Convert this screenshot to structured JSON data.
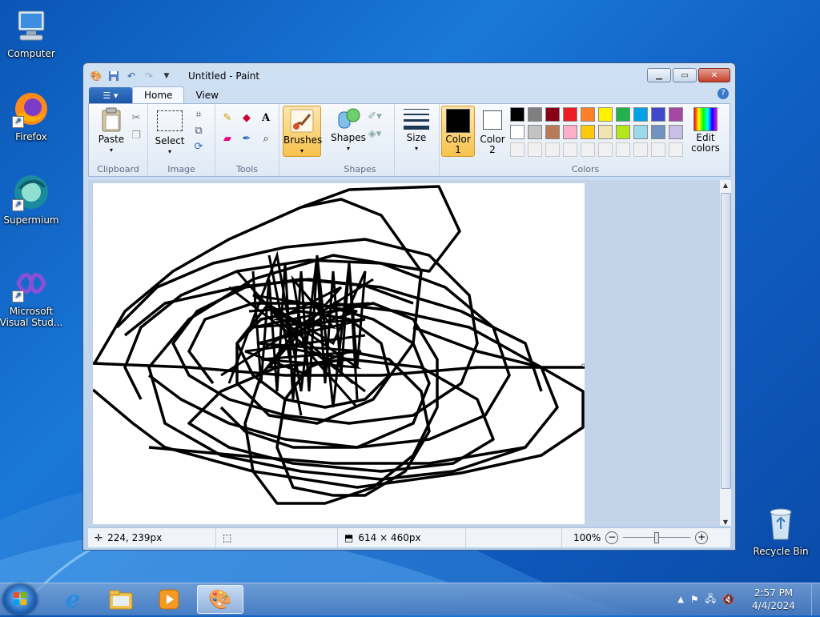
{
  "desktop": {
    "icons": [
      {
        "label": "Computer",
        "icon": "computer-icon"
      },
      {
        "label": "Firefox",
        "icon": "firefox-icon"
      },
      {
        "label": "Supermium",
        "icon": "supermium-icon"
      },
      {
        "label": "Microsoft Visual Stud...",
        "icon": "visual-studio-icon"
      },
      {
        "label": "Recycle Bin",
        "icon": "recycle-bin-icon"
      }
    ]
  },
  "window": {
    "title": "Untitled - Paint",
    "tabs": [
      "Home",
      "View"
    ],
    "active_tab": "Home"
  },
  "ribbon": {
    "clipboard": {
      "label": "Clipboard",
      "paste": "Paste"
    },
    "image": {
      "label": "Image",
      "select": "Select"
    },
    "tools": {
      "label": "Tools"
    },
    "brushes": {
      "label": "Brushes"
    },
    "shapes": {
      "label": "Shapes",
      "shapes_btn": "Shapes"
    },
    "size": {
      "label": "Size"
    },
    "colors": {
      "label": "Colors",
      "color1": "Color 1",
      "color2": "Color 2",
      "edit": "Edit colors",
      "color1_value": "#000000",
      "color2_value": "#ffffff",
      "palette_row1": [
        "#000000",
        "#7f7f7f",
        "#880015",
        "#ed1c24",
        "#ff7f27",
        "#fff200",
        "#22b14c",
        "#00a2e8",
        "#3f48cc",
        "#a349a4"
      ],
      "palette_row2": [
        "#ffffff",
        "#c3c3c3",
        "#b97a57",
        "#ffaec9",
        "#ffc90e",
        "#efe4b0",
        "#b5e61d",
        "#99d9ea",
        "#7092be",
        "#c8bfe7"
      ]
    }
  },
  "status": {
    "cursor_pos": "224, 239px",
    "canvas_size": "614 × 460px",
    "zoom": "100%",
    "zoom_level": 0.5
  },
  "taskbar": {
    "time": "2:57 PM",
    "date": "4/4/2024"
  }
}
